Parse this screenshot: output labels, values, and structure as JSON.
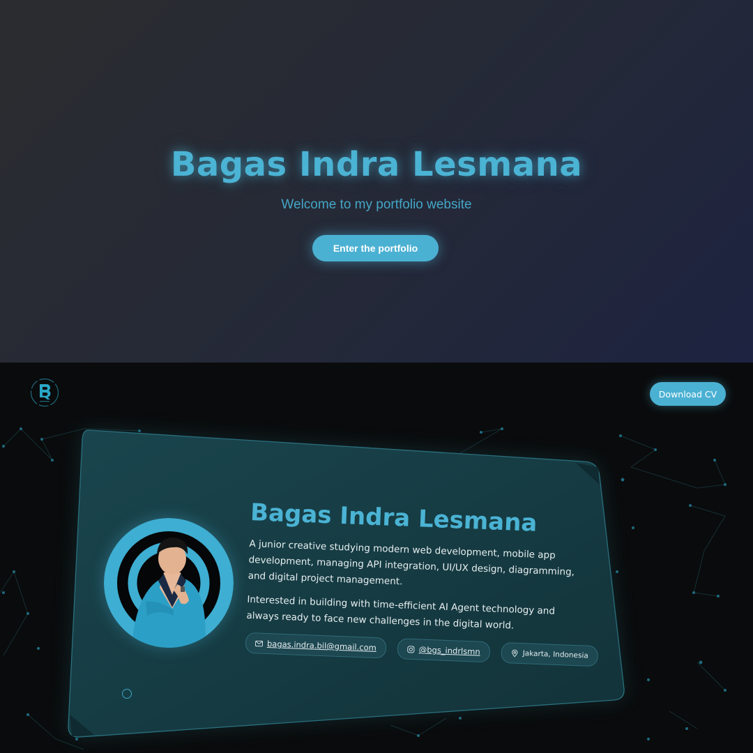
{
  "hero": {
    "title": "Bagas Indra Lesmana",
    "subtitle": "Welcome to my portfolio website",
    "enter_label": "Enter the portfolio"
  },
  "header": {
    "logo_icon": "bagas-b-logo-icon",
    "download_cv_label": "Download CV"
  },
  "profile": {
    "name": "Bagas Indra Lesmana",
    "bio_1": "A junior creative studying modern web development, mobile app development, managing API integration, UI/UX design, diagramming, and digital project management.",
    "bio_2": "Interested in building with time-efficient AI Agent technology and always ready to face new challenges in the digital world.",
    "email": "bagas.indra.bil@gmail.com",
    "instagram": "@bgs_indrlsmn",
    "location": "Jakarta, Indonesia"
  },
  "colors": {
    "accent": "#4bb3d4",
    "card_bg": "#163a41",
    "page_bg": "#0a0b0c"
  }
}
